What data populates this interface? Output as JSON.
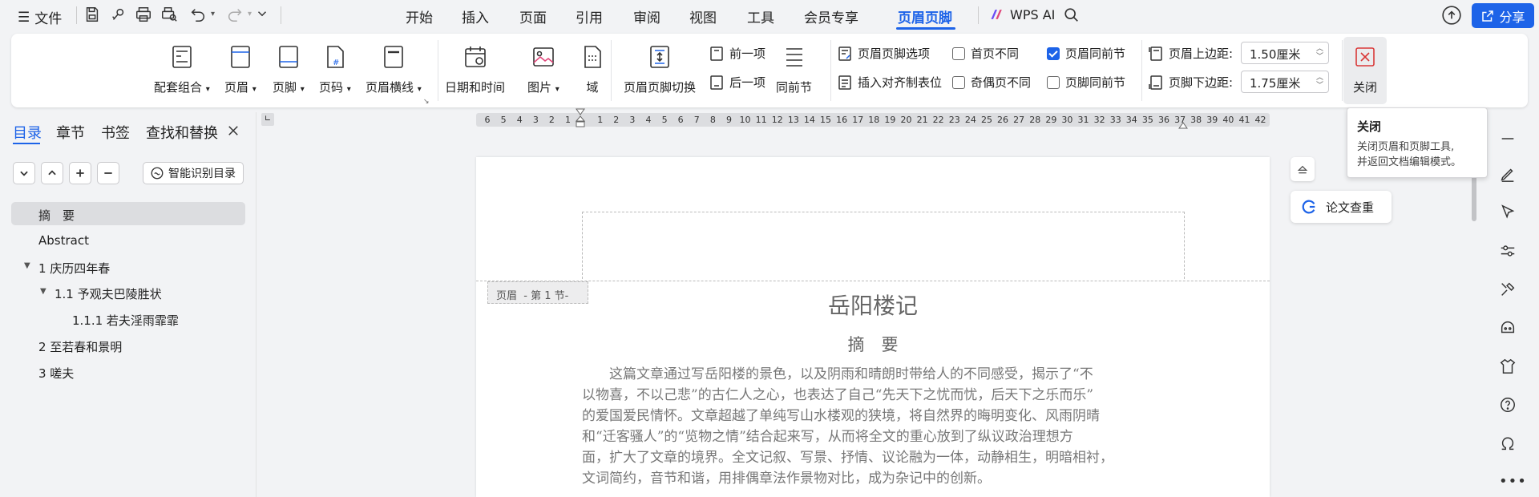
{
  "topbar": {
    "file_label": "文件",
    "menu": [
      "开始",
      "插入",
      "页面",
      "引用",
      "审阅",
      "视图",
      "工具",
      "会员专享",
      "页眉页脚"
    ],
    "active_menu": "页眉页脚",
    "wps_ai_label": "WPS AI",
    "share_label": "分享"
  },
  "ribbon": {
    "combo_label": "配套组合",
    "header_label": "页眉",
    "footer_label": "页脚",
    "pagenum_label": "页码",
    "header_line_label": "页眉横线",
    "datetime_label": "日期和时间",
    "picture_label": "图片",
    "field_label": "域",
    "switch_label": "页眉页脚切换",
    "prev_label": "前一项",
    "next_label": "后一项",
    "same_section_label": "同前节",
    "options_label": "页眉页脚选项",
    "align_tab_label": "插入对齐制表位",
    "diff_first_label": "首页不同",
    "diff_odd_even_label": "奇偶页不同",
    "header_same_label": "页眉同前节",
    "footer_same_label": "页脚同前节",
    "diff_first_checked": false,
    "diff_odd_even_checked": false,
    "header_same_checked": true,
    "footer_same_checked": false,
    "top_margin_label": "页眉上边距:",
    "top_margin_value": "1.50厘米",
    "bottom_margin_label": "页脚下边距:",
    "bottom_margin_value": "1.75厘米",
    "close_label": "关闭"
  },
  "tooltip": {
    "title": "关闭",
    "line1": "关闭页眉和页脚工具,",
    "line2": "并返回文档编辑模式。"
  },
  "nav": {
    "tabs": [
      "目录",
      "章节",
      "书签",
      "查找和替换"
    ],
    "smart_toc_label": "智能识别目录",
    "toc": [
      {
        "label": "摘　要"
      },
      {
        "label": "Abstract"
      },
      {
        "label": "1 庆历四年春"
      },
      {
        "label": "1.1 予观夫巴陵胜状"
      },
      {
        "label": "1.1.1 若夫淫雨霏霏"
      },
      {
        "label": "2 至若春和景明"
      },
      {
        "label": "3 嗟夫"
      }
    ]
  },
  "ruler": {
    "ticks": [
      "6",
      "5",
      "4",
      "3",
      "2",
      "1",
      "",
      "1",
      "2",
      "3",
      "4",
      "5",
      "6",
      "7",
      "8",
      "9",
      "10",
      "11",
      "12",
      "13",
      "14",
      "15",
      "16",
      "17",
      "18",
      "19",
      "20",
      "21",
      "22",
      "23",
      "24",
      "25",
      "26",
      "27",
      "28",
      "29",
      "30",
      "31",
      "32",
      "33",
      "34",
      "35",
      "36",
      "37",
      "38",
      "39",
      "40",
      "41",
      "42"
    ]
  },
  "document": {
    "header_tag": "页眉  - 第 1 节-",
    "title": "岳阳楼记",
    "subtitle": "摘　要",
    "paragraph_lines": [
      "　　这篇文章通过写岳阳楼的景色，以及阴雨和晴朗时带给人的不同感受，揭示了“不",
      "以物喜，不以己悲”的古仁人之心，也表达了自己“先天下之忧而忧，后天下之乐而乐”",
      "的爱国爱民情怀。文章超越了单纯写山水楼观的狭境，将自然界的晦明变化、风雨阴晴",
      "和“迁客骚人”的“览物之情”结合起来写，从而将全文的重心放到了纵议政治理想方",
      "面，扩大了文章的境界。全文记叙、写景、抒情、议论融为一体，动静相生，明暗相衬，",
      "文词简约，音节和谐，用排偶章法作景物对比，成为杂记中的创新。"
    ]
  },
  "plagiarism_check_label": "论文查重",
  "colors": {
    "accent": "#1d63e8",
    "bg": "#f2f3f5"
  }
}
